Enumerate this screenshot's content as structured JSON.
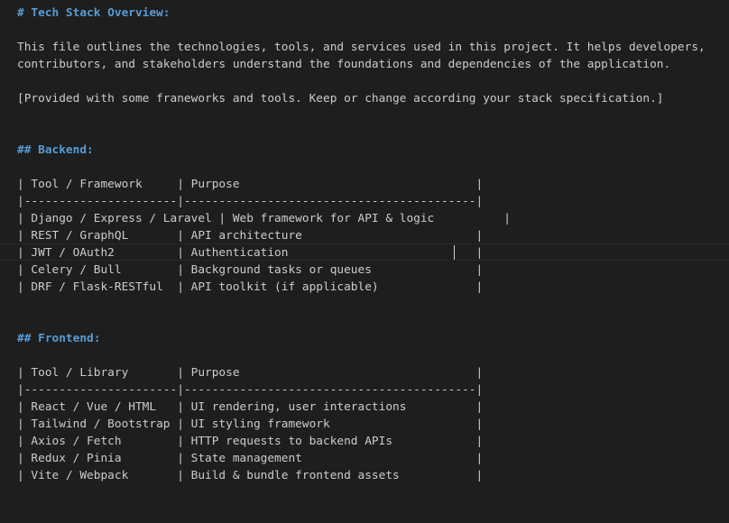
{
  "top_partial": "",
  "title": "# Tech Stack Overview:",
  "intro": {
    "line1": "This file outlines the technologies, tools, and services used in this project. It helps developers,",
    "line2": "contributors, and stakeholders understand the foundations and dependencies of the application.",
    "note": "[Provided with some franeworks and tools. Keep or change according your stack specification.]"
  },
  "backend": {
    "heading": "## Backend:",
    "header_row": "| Tool / Framework     | Purpose                                  |",
    "separator": "|----------------------|------------------------------------------|",
    "rows": [
      "| Django / Express / Laravel | Web framework for API & logic          |",
      "| REST / GraphQL       | API architecture                         |",
      "| JWT / OAuth2         | Authentication                           |",
      "| Celery / Bull        | Background tasks or queues               |",
      "| DRF / Flask-RESTful  | API toolkit (if applicable)              |"
    ]
  },
  "frontend": {
    "heading": "## Frontend:",
    "header_row": "| Tool / Library       | Purpose                                  |",
    "separator": "|----------------------|------------------------------------------|",
    "rows": [
      "| React / Vue / HTML   | UI rendering, user interactions          |",
      "| Tailwind / Bootstrap | UI styling framework                     |",
      "| Axios / Fetch        | HTTP requests to backend APIs            |",
      "| Redux / Pinia        | State management                         |",
      "| Vite / Webpack       | Build & bundle frontend assets           |"
    ]
  },
  "colors": {
    "background": "#1e1e1e",
    "text": "#cccccc",
    "heading": "#569cd6"
  }
}
